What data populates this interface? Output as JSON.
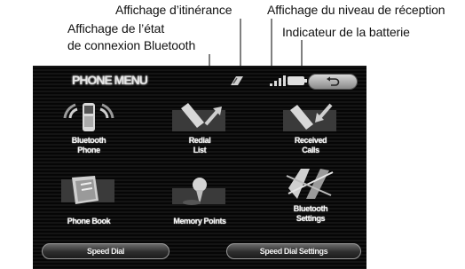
{
  "callouts": {
    "roaming": "Affichage d’itinérance",
    "bt_status_line1": "Affichage de l’état",
    "bt_status_line2": "de connexion Bluetooth",
    "reception": "Affichage du niveau de réception",
    "battery": "Indicateur de la batterie"
  },
  "screen": {
    "title": "PHONE MENU",
    "back_icon": "return-arrow-icon",
    "buttons": [
      {
        "line1": "Bluetooth",
        "line2": "Phone",
        "icon": "bluetooth-phone-icon"
      },
      {
        "line1": "Redial",
        "line2": "List",
        "icon": "redial-phone-icon"
      },
      {
        "line1": "Received",
        "line2": "Calls",
        "icon": "received-phone-icon"
      },
      {
        "line1": "Phone Book",
        "line2": "",
        "icon": "phone-book-icon"
      },
      {
        "line1": "Memory Points",
        "line2": "",
        "icon": "memory-pin-icon"
      },
      {
        "line1": "Bluetooth",
        "line2": "Settings",
        "icon": "bluetooth-settings-icon"
      }
    ],
    "bottom": {
      "speed_dial": "Speed Dial",
      "speed_dial_settings": "Speed Dial Settings"
    }
  }
}
